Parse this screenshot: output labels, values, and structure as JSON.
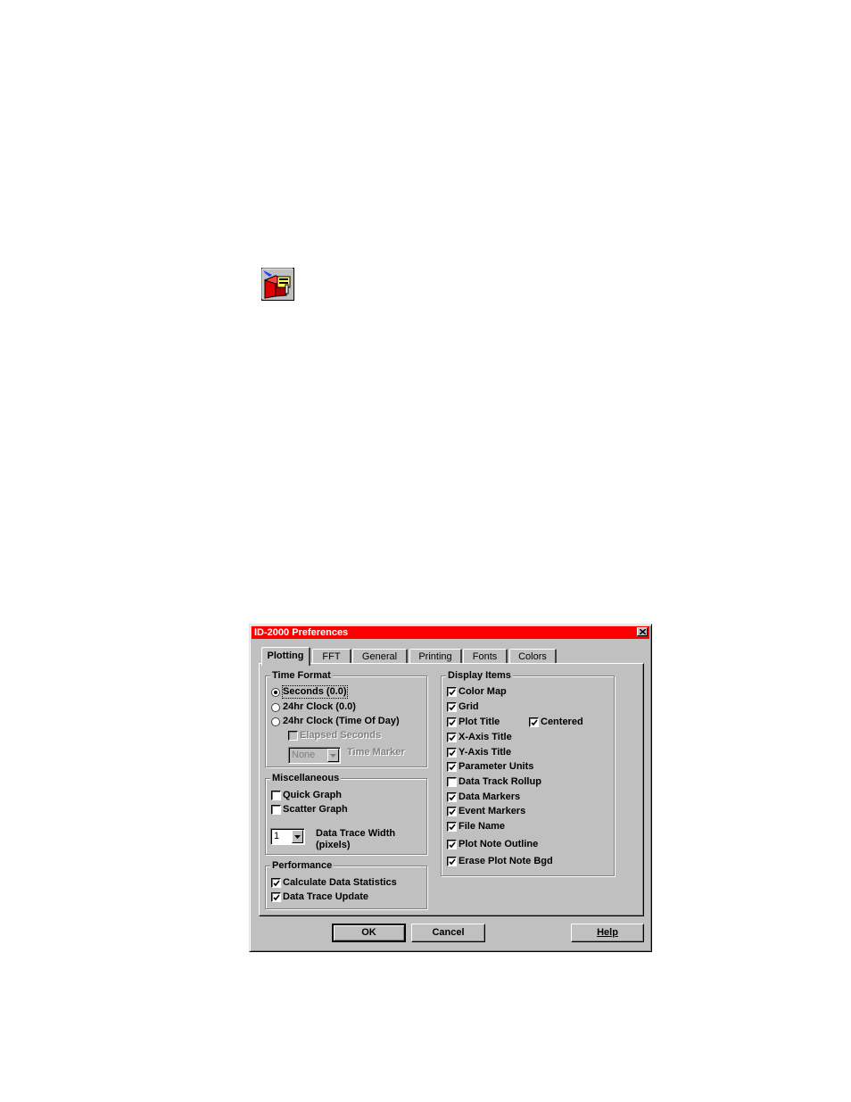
{
  "dialog": {
    "title": "ID-2000 Preferences",
    "title_bar_color": "#ff0000",
    "tabs": [
      {
        "label": "Plotting",
        "active": true
      },
      {
        "label": "FFT",
        "active": false
      },
      {
        "label": "General",
        "active": false
      },
      {
        "label": "Printing",
        "active": false
      },
      {
        "label": "Fonts",
        "active": false
      },
      {
        "label": "Colors",
        "active": false
      }
    ],
    "time_format": {
      "label": "Time Format",
      "options": [
        {
          "label": "Seconds (0.0)",
          "selected": true
        },
        {
          "label": "24hr Clock (0.0)",
          "selected": false
        },
        {
          "label": "24hr Clock (Time Of Day)",
          "selected": false
        }
      ],
      "elapsed_seconds": {
        "label": "Elapsed Seconds",
        "checked": false,
        "enabled": false
      },
      "time_marker": {
        "value": "None",
        "label": "Time Marker",
        "enabled": false
      }
    },
    "miscellaneous": {
      "label": "Miscellaneous",
      "items": [
        {
          "label": "Quick Graph",
          "checked": false
        },
        {
          "label": "Scatter Graph",
          "checked": false
        }
      ],
      "data_trace_width": {
        "value": "1",
        "label": "Data Trace Width",
        "sublabel": "(pixels)"
      }
    },
    "performance": {
      "label": "Performance",
      "items": [
        {
          "label": "Calculate Data Statistics",
          "checked": true
        },
        {
          "label": "Data Trace Update",
          "checked": true
        }
      ]
    },
    "display_items": {
      "label": "Display Items",
      "items": [
        {
          "label": "Color Map",
          "checked": true
        },
        {
          "label": "Grid",
          "checked": true
        },
        {
          "label": "Plot Title",
          "checked": true
        },
        {
          "label": "X-Axis Title",
          "checked": true
        },
        {
          "label": "Y-Axis Title",
          "checked": true
        },
        {
          "label": "Parameter Units",
          "checked": true
        },
        {
          "label": "Data Track Rollup",
          "checked": false
        },
        {
          "label": "Data Markers",
          "checked": true
        },
        {
          "label": "Event Markers",
          "checked": true
        },
        {
          "label": "File Name",
          "checked": true
        },
        {
          "label": "Plot Note Outline",
          "checked": true
        },
        {
          "label": "Erase Plot Note Bgd",
          "checked": true
        }
      ],
      "centered": {
        "label": "Centered",
        "checked": true
      }
    },
    "buttons": {
      "ok": "OK",
      "cancel": "Cancel",
      "help": "Help"
    }
  },
  "icons": {
    "app": "app-icon",
    "close": "close-icon",
    "check": "check-icon",
    "dropdown": "chevron-down-icon"
  }
}
